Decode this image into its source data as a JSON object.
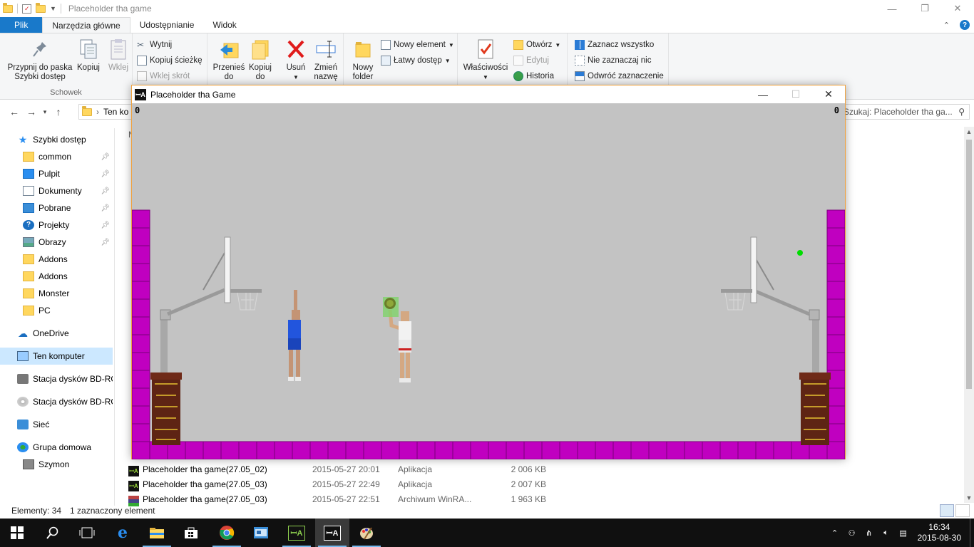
{
  "explorer": {
    "title": "Placeholder tha game",
    "tabs": [
      "Plik",
      "Narzędzia główne",
      "Udostępnianie",
      "Widok"
    ],
    "ribbon": {
      "pin_label": "Przypnij do paska Szybki dostęp",
      "copy_label": "Kopiuj",
      "paste_label": "Wklej",
      "cut_label": "Wytnij",
      "copy_path_label": "Kopiuj ścieżkę",
      "paste_shortcut_label": "Wklej skrót",
      "clipboard_group": "Schowek",
      "move_to_label": "Przenieś do",
      "copy_to_label": "Kopiuj do",
      "delete_label": "Usuń",
      "rename_label": "Zmień nazwę",
      "new_folder_label": "Nowy folder",
      "new_item_label": "Nowy element",
      "easy_access_label": "Łatwy dostęp",
      "properties_label": "Właściwości",
      "open_label": "Otwórz",
      "edit_label": "Edytuj",
      "history_label": "Historia",
      "select_all_label": "Zaznacz wszystko",
      "select_none_label": "Nie zaznaczaj nic",
      "invert_selection_label": "Odwróć zaznaczenie"
    },
    "address": "Ten ko",
    "search_placeholder": "Szukaj: Placeholder tha ga...",
    "sidebar": [
      {
        "label": "Szybki dostęp",
        "icon": "star-icon",
        "pinned": false
      },
      {
        "label": "common",
        "icon": "folder-icon",
        "pinned": true
      },
      {
        "label": "Pulpit",
        "icon": "desktop-icon",
        "pinned": true
      },
      {
        "label": "Dokumenty",
        "icon": "documents-icon",
        "pinned": true
      },
      {
        "label": "Pobrane",
        "icon": "downloads-icon",
        "pinned": true
      },
      {
        "label": "Projekty",
        "icon": "help-icon",
        "pinned": true
      },
      {
        "label": "Obrazy",
        "icon": "pictures-icon",
        "pinned": true
      },
      {
        "label": "Addons",
        "icon": "folder-icon",
        "pinned": false
      },
      {
        "label": "Addons",
        "icon": "folder-icon",
        "pinned": false
      },
      {
        "label": "Monster",
        "icon": "folder-icon",
        "pinned": false
      },
      {
        "label": "PC",
        "icon": "folder-icon",
        "pinned": false
      },
      {
        "label": "OneDrive",
        "icon": "cloud-icon",
        "pinned": false
      },
      {
        "label": "Ten komputer",
        "icon": "computer-icon",
        "pinned": false
      },
      {
        "label": "Stacja dysków BD-RO",
        "icon": "drive-icon",
        "pinned": false
      },
      {
        "label": "Stacja dysków BD-RO",
        "icon": "disc-icon",
        "pinned": false
      },
      {
        "label": "Sieć",
        "icon": "network-icon",
        "pinned": false
      },
      {
        "label": "Grupa domowa",
        "icon": "homegroup-icon",
        "pinned": false
      },
      {
        "label": "Szymon",
        "icon": "user-icon",
        "pinned": false
      }
    ],
    "column_header_fragment": "N",
    "files": [
      {
        "name": "Placeholder tha game(27.05_02)",
        "date": "2015-05-27 20:01",
        "type": "Aplikacja",
        "size": "2 006 KB",
        "icon": "game-icon"
      },
      {
        "name": "Placeholder tha game(27.05_03)",
        "date": "2015-05-27 22:49",
        "type": "Aplikacja",
        "size": "2 007 KB",
        "icon": "game-icon"
      },
      {
        "name": "Placeholder tha game(27.05_03)",
        "date": "2015-05-27 22:51",
        "type": "Archiwum WinRA...",
        "size": "1 963 KB",
        "icon": "rar-icon"
      }
    ],
    "status": {
      "count": "Elementy: 34",
      "selected": "1 zaznaczony element"
    }
  },
  "game": {
    "title": "Placeholder tha Game",
    "icon_text": "ꟷA",
    "score_left": "0",
    "score_right": "0",
    "colors": {
      "court": "#c3c3c3",
      "wall": "#c000c0",
      "brick": "#7a2e1c",
      "blue_jersey": "#2255dd",
      "white_jersey": "#f2f2f2",
      "ball": "#6fbf3f",
      "marker": "#00dd00"
    }
  },
  "taskbar": {
    "items": [
      "windows-start-icon",
      "search-icon",
      "task-view-icon",
      "edge-icon",
      "file-explorer-icon",
      "store-icon",
      "chrome-icon",
      "app-icon",
      "game-icon",
      "game-icon",
      "paint-icon"
    ],
    "clock_time": "16:34",
    "clock_date": "2015-08-30"
  }
}
